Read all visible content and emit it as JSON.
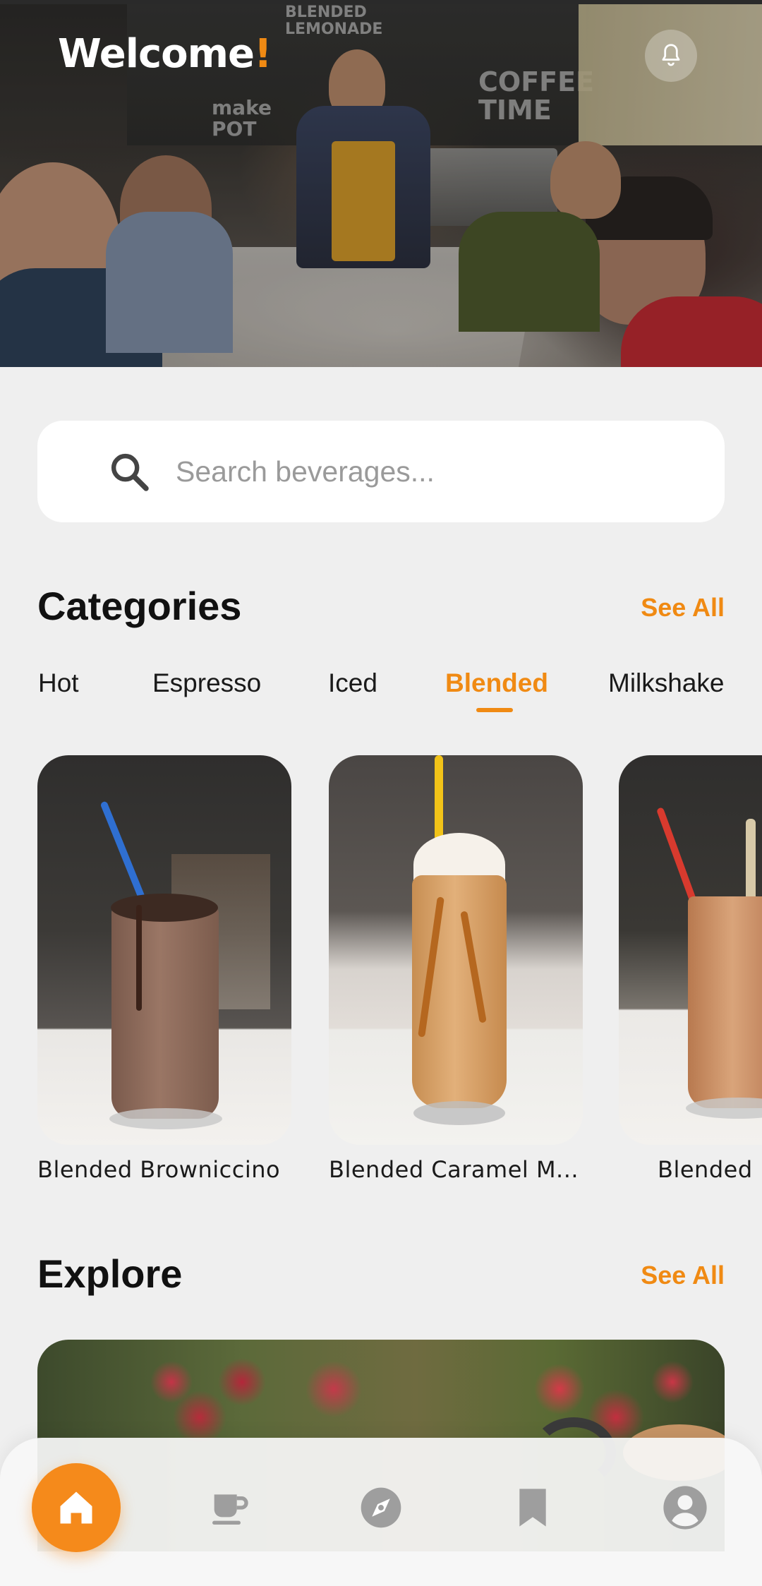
{
  "header": {
    "welcome_text": "Welcome",
    "welcome_mark": "!",
    "hero_chalk": [
      "BLENDED LEMONADE",
      "COFFEE TIME",
      "make POT"
    ]
  },
  "search": {
    "placeholder": "Search beverages..."
  },
  "categories": {
    "title": "Categories",
    "see_all": "See All",
    "tabs": [
      {
        "label": "Hot",
        "active": false
      },
      {
        "label": "Espresso",
        "active": false
      },
      {
        "label": "Iced",
        "active": false
      },
      {
        "label": "Blended",
        "active": true
      },
      {
        "label": "Milkshake",
        "active": false
      }
    ]
  },
  "products": [
    {
      "name": "Blended Browniccino"
    },
    {
      "name": "Blended Caramel M..."
    },
    {
      "name": "Blended"
    }
  ],
  "explore": {
    "title": "Explore",
    "see_all": "See All"
  },
  "bottom_nav": {
    "items": [
      {
        "icon": "home-icon",
        "active": true
      },
      {
        "icon": "coffee-cup-icon",
        "active": false
      },
      {
        "icon": "compass-icon",
        "active": false
      },
      {
        "icon": "bookmark-icon",
        "active": false
      },
      {
        "icon": "profile-icon",
        "active": false
      }
    ]
  },
  "colors": {
    "accent": "#f08a13",
    "background": "#efefef",
    "text": "#111111",
    "inactive_icon": "#9e9e9e"
  }
}
